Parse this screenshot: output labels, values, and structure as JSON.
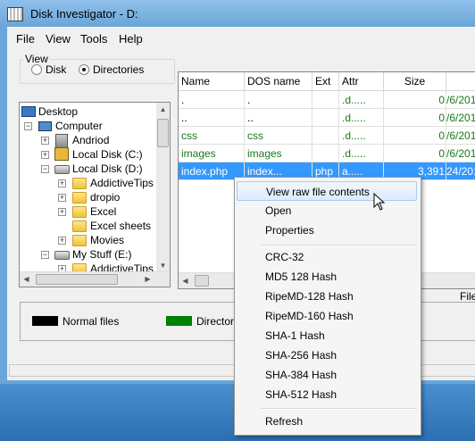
{
  "window": {
    "title": "Disk Investigator - D:"
  },
  "menu": [
    "File",
    "View",
    "Tools",
    "Help"
  ],
  "view_group": {
    "legend": "View",
    "options": [
      {
        "label": "Disk",
        "selected": false
      },
      {
        "label": "Directories",
        "selected": true
      }
    ]
  },
  "tree": [
    {
      "label": "Desktop",
      "icon": "desktop-icon"
    },
    {
      "label": "Computer",
      "icon": "computer-icon"
    },
    {
      "label": "Andriod",
      "icon": "device-icon"
    },
    {
      "label": "Local Disk (C:)",
      "icon": "drive-icon"
    },
    {
      "label": "Local Disk (D:)",
      "icon": "drive-icon"
    },
    {
      "label": "AddictiveTips",
      "icon": "folder-icon"
    },
    {
      "label": "dropio",
      "icon": "folder-icon"
    },
    {
      "label": "Excel",
      "icon": "folder-icon"
    },
    {
      "label": "Excel sheets",
      "icon": "folder-icon"
    },
    {
      "label": "Movies",
      "icon": "folder-icon"
    },
    {
      "label": "My Stuff (E:)",
      "icon": "drive-icon"
    },
    {
      "label": "AddictiveTips",
      "icon": "folder-icon"
    }
  ],
  "file_list": {
    "columns": [
      "Name",
      "DOS name",
      "Ext",
      "Attr",
      "Size",
      ""
    ],
    "rows": [
      {
        "name": ".",
        "dos": ".",
        "ext": "",
        "attr": ".d.....",
        "size": "0",
        "date": "/6/201"
      },
      {
        "name": "..",
        "dos": "..",
        "ext": "",
        "attr": ".d.....",
        "size": "0",
        "date": "/6/201"
      },
      {
        "name": "css",
        "dos": "css",
        "ext": "",
        "attr": ".d.....",
        "size": "0",
        "date": "/6/201"
      },
      {
        "name": "images",
        "dos": "images",
        "ext": "",
        "attr": ".d.....",
        "size": "0",
        "date": "/6/201"
      },
      {
        "name": "index.php",
        "dos": "index...",
        "ext": "php",
        "attr": "a.....",
        "size": "3,391",
        "date": "24/201"
      }
    ]
  },
  "legend": {
    "items": [
      {
        "label": "Normal files",
        "color": "#000000"
      },
      {
        "label": "Directorie",
        "color": "#008000"
      }
    ],
    "right_text": "File"
  },
  "context_menu": {
    "items": [
      "View raw file contents",
      "Open",
      "Properties",
      "CRC-32",
      "MD5 128 Hash",
      "RipeMD-128 Hash",
      "RipeMD-160 Hash",
      "SHA-1 Hash",
      "SHA-256 Hash",
      "SHA-384 Hash",
      "SHA-512 Hash",
      "Refresh"
    ]
  },
  "colors": {
    "directory": "#1a7a1a",
    "selection": "#3399ff",
    "titlebar": "#6aa6d8"
  }
}
